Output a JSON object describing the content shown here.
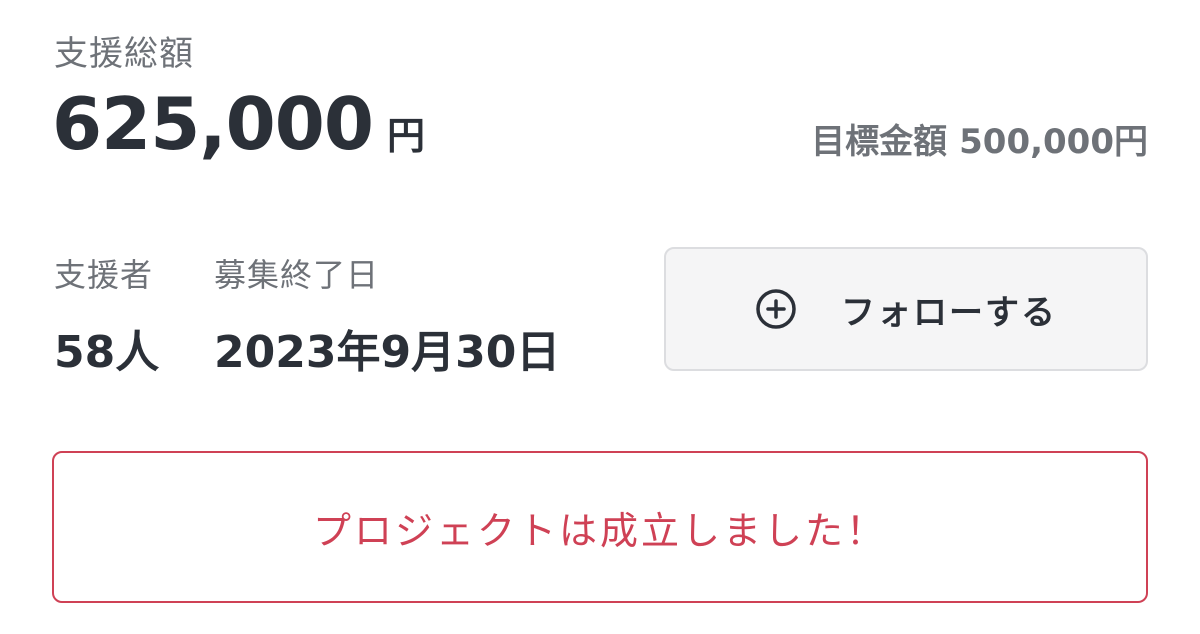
{
  "funding": {
    "total_label": "支援総額",
    "total_amount": "625,000",
    "total_unit": "円",
    "goal_label": "目標金額",
    "goal_amount": "500,000円"
  },
  "stats": {
    "backers_label": "支援者",
    "backers_value": "58人",
    "deadline_label": "募集終了日",
    "deadline_value": "2023年9月30日"
  },
  "follow": {
    "label": "フォローする",
    "icon": "plus-circle-icon"
  },
  "status": {
    "message": "プロジェクトは成立しました！"
  },
  "colors": {
    "text_primary": "#2b3038",
    "text_secondary": "#6e7278",
    "accent_success": "#cf4155",
    "button_bg": "#f5f5f6",
    "button_border": "#dcdde0"
  }
}
